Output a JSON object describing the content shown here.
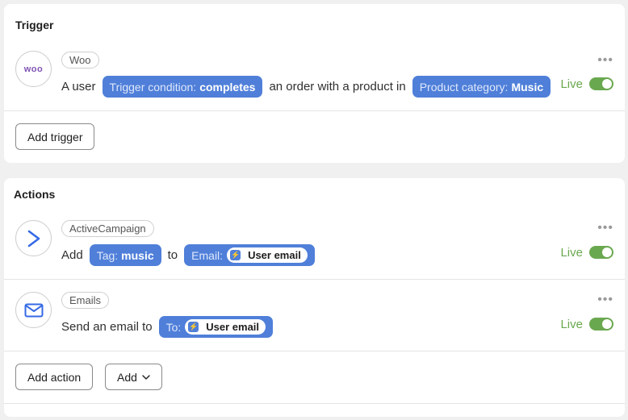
{
  "trigger": {
    "title": "Trigger",
    "app": "Woo",
    "logo_text": "woo",
    "sentence_start": "A user",
    "condition_label": "Trigger condition:",
    "condition_value": "completes",
    "sentence_mid": "an order with a product in",
    "category_label": "Product category:",
    "category_value": "Music",
    "status": "Live",
    "add_button": "Add trigger"
  },
  "actions": {
    "title": "Actions",
    "items": [
      {
        "app": "ActiveCampaign",
        "verb": "Add",
        "tag_label": "Tag:",
        "tag_value": "music",
        "connector": "to",
        "email_label": "Email:",
        "email_value": "User email",
        "status": "Live"
      },
      {
        "app": "Emails",
        "verb": "Send an email to",
        "to_label": "To:",
        "to_value": "User email",
        "status": "Live"
      }
    ],
    "add_action_button": "Add action",
    "add_button": "Add"
  },
  "colors": {
    "pill": "#4f7fd9",
    "live": "#6aa84f",
    "woo_brand": "#7f54b3"
  },
  "icons": {
    "more": "more-horizontal-icon",
    "bolt": "lightning-bolt-icon",
    "activecampaign": "activecampaign-chevron-icon",
    "email": "envelope-icon",
    "chevron": "chevron-down-icon"
  }
}
